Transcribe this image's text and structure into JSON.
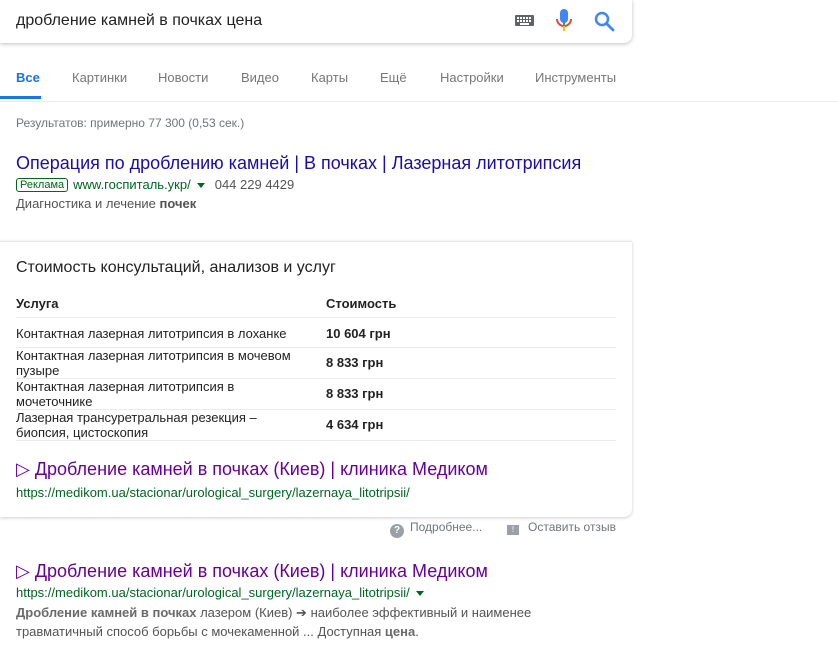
{
  "search": {
    "query": "дробление камней в почках цена"
  },
  "tabs": [
    "Все",
    "Картинки",
    "Новости",
    "Видео",
    "Карты",
    "Ещё",
    "Настройки",
    "Инструменты"
  ],
  "result_stats": "Результатов: примерно 77 300 (0,53 сек.)",
  "ad": {
    "title": "Операция по дроблению камней | В почках | Лазерная литотрипсия",
    "badge": "Реклама",
    "url": "www.госпиталь.укр/",
    "phone": "044 229 4429",
    "desc_plain": "Диагностика и лечение ",
    "desc_bold": "почек"
  },
  "card": {
    "title": "Стоимость консультаций, анализов и услуг",
    "col_service": "Услуга",
    "col_price": "Стоимость",
    "rows": [
      {
        "name": "Контактная лазерная литотрипсия в лоханке",
        "price": "10 604 грн"
      },
      {
        "name": "Контактная лазерная литотрипсия в мочевом пузыре",
        "price": "8 833 грн"
      },
      {
        "name": "Контактная лазерная литотрипсия в мочеточнике",
        "price": "8 833 грн"
      },
      {
        "name": "Лазерная трансуретральная резекция – биопсия, цистоскопия",
        "price": "4 634 грн"
      }
    ],
    "link_title": "▷ Дробление камней в почках (Киев) | клиника Медиком",
    "link_url": "https://medikom.ua/stacionar/urological_surgery/lazernaya_litotripsii/"
  },
  "feedback": {
    "more": "Подробнее...",
    "leave": "Оставить отзыв"
  },
  "result2": {
    "title": "▷ Дробление камней в почках (Киев) | клиника Медиком",
    "url": "https://medikom.ua/stacionar/urological_surgery/lazernaya_litotripsii/",
    "desc_bold1": "Дробление камней в почках",
    "desc_text1": " лазером (Киев) ➔ наиболее эффективный и наименее травматичный способ борьбы с мочекаменной ... Доступная ",
    "desc_bold2": "цена",
    "desc_text2": "."
  },
  "colors": {
    "link": "#1a0dab",
    "visited": "#660099",
    "url": "#006621",
    "accent": "#1a73e8"
  },
  "icons": [
    "keyboard-icon",
    "mic-icon",
    "search-icon",
    "help-icon",
    "feedback-icon",
    "caret-down-icon"
  ]
}
